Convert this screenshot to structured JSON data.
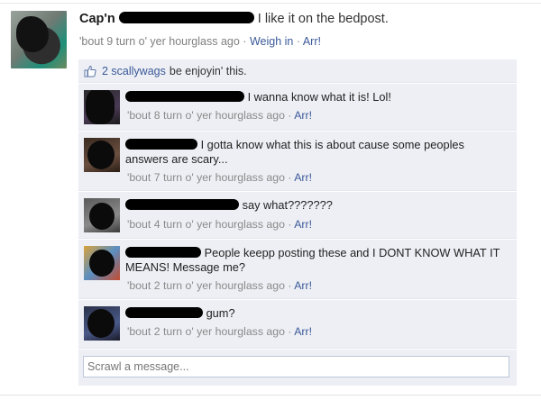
{
  "post": {
    "author": "Cap'n",
    "message": "I like it on the bedpost.",
    "timestamp": "'bout 9 turn o' yer hourglass ago",
    "like_action": "Weigh in",
    "comment_action": "Arr!",
    "separator": "·"
  },
  "likes": {
    "icon": "thumbs-up-icon",
    "count_text": "2 scallywags",
    "suffix": "be enjoyin' this."
  },
  "comments": [
    {
      "text": "I wanna know what it is! Lol!",
      "time": "'bout 8 turn o' yer hourglass ago",
      "action": "Arr!"
    },
    {
      "text": "I gotta know what this is about cause some peoples answers are scary...",
      "time": "'bout 7 turn o' yer hourglass ago",
      "action": "Arr!"
    },
    {
      "text": "say what???????",
      "time": "'bout 4 turn o' yer hourglass ago",
      "action": "Arr!"
    },
    {
      "text": "People keepp posting these and I DONT KNOW WHAT IT MEANS! Message me?",
      "time": "'bout 2 turn o' yer hourglass ago",
      "action": "Arr!"
    },
    {
      "text": "gum?",
      "time": "'bout 2 turn o' yer hourglass ago",
      "action": "Arr!"
    }
  ],
  "reply": {
    "placeholder": "Scrawl a message..."
  },
  "colors": {
    "link": "#3b5998",
    "comment_bg": "#edeff4",
    "meta": "#808080"
  }
}
